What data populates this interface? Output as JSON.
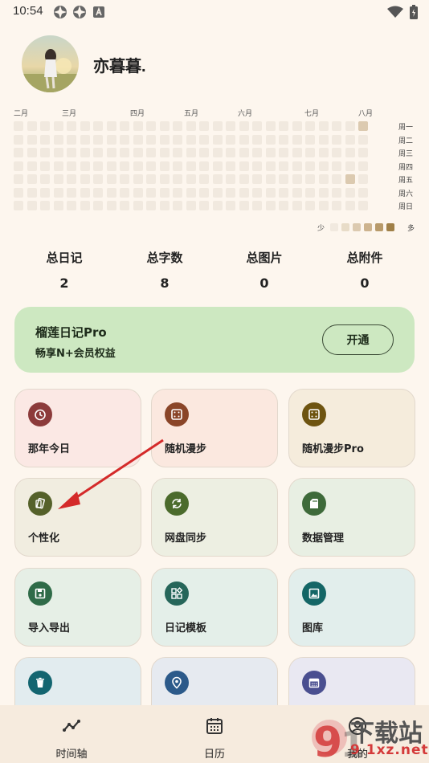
{
  "status": {
    "time": "10:54"
  },
  "profile": {
    "name": "亦暮暮."
  },
  "heatmap": {
    "months": [
      "二月",
      "三月",
      "四月",
      "五月",
      "六月",
      "七月",
      "八月"
    ],
    "days": [
      "周一",
      "周二",
      "周三",
      "周四",
      "周五",
      "周六",
      "周日"
    ],
    "legend_less": "少",
    "legend_more": "多",
    "colors": [
      "#f1e9df",
      "#e8dcc8",
      "#dccab0",
      "#cdb38e",
      "#b89a6a",
      "#a08048"
    ]
  },
  "stats": [
    {
      "label": "总日记",
      "value": "2"
    },
    {
      "label": "总字数",
      "value": "8"
    },
    {
      "label": "总图片",
      "value": "0"
    },
    {
      "label": "总附件",
      "value": "0"
    }
  ],
  "pro": {
    "title": "榴莲日记Pro",
    "subtitle": "畅享N+会员权益",
    "button": "开通"
  },
  "tiles": [
    {
      "label": "那年今日",
      "icon": "timer-icon"
    },
    {
      "label": "随机漫步",
      "icon": "dice-icon"
    },
    {
      "label": "随机漫步Pro",
      "icon": "dice-icon"
    },
    {
      "label": "个性化",
      "icon": "palette-icon"
    },
    {
      "label": "网盘同步",
      "icon": "sync-icon"
    },
    {
      "label": "数据管理",
      "icon": "sd-card-icon"
    },
    {
      "label": "导入导出",
      "icon": "save-icon"
    },
    {
      "label": "日记模板",
      "icon": "widgets-icon"
    },
    {
      "label": "图库",
      "icon": "image-icon"
    },
    {
      "label": "",
      "icon": "trash-icon"
    },
    {
      "label": "",
      "icon": "location-icon"
    },
    {
      "label": "",
      "icon": "calendar-icon"
    }
  ],
  "nav": [
    {
      "label": "时间轴",
      "icon": "timeline-icon"
    },
    {
      "label": "日历",
      "icon": "calendar-icon"
    },
    {
      "label": "我的",
      "icon": "profile-icon"
    }
  ],
  "watermark": {
    "text": "下载站",
    "domain": "9 1xz.net"
  }
}
